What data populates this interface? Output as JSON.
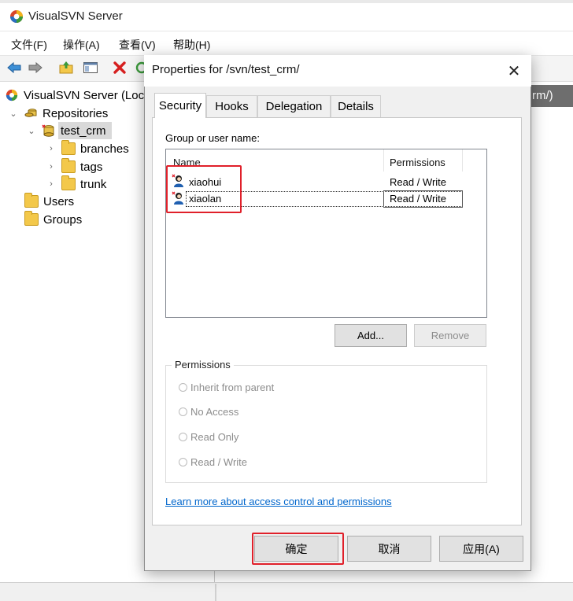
{
  "main_window": {
    "title": "VisualSVN Server",
    "menu": [
      "文件(F)",
      "操作(A)",
      "查看(V)",
      "帮助(H)"
    ],
    "right_header_text": "rm/)"
  },
  "tree": {
    "root": "VisualSVN Server (Loc",
    "repositories": "Repositories",
    "repo": "test_crm",
    "children": [
      "branches",
      "tags",
      "trunk"
    ],
    "users": "Users",
    "groups": "Groups"
  },
  "dialog": {
    "title": "Properties for /svn/test_crm/",
    "tabs": [
      "Security",
      "Hooks",
      "Delegation",
      "Details"
    ],
    "active_tab": "Security",
    "group_label": "Group or user name:",
    "columns": {
      "name": "Name",
      "permissions": "Permissions"
    },
    "users": [
      {
        "name": "xiaohui",
        "permission": "Read / Write"
      },
      {
        "name": "xiaolan",
        "permission": "Read / Write"
      }
    ],
    "add_button": "Add...",
    "remove_button": "Remove",
    "permissions_legend": "Permissions",
    "permission_options": [
      "Inherit from parent",
      "No Access",
      "Read Only",
      "Read / Write"
    ],
    "learn_link": "Learn more about access control and permissions",
    "ok_button": "确定",
    "cancel_button": "取消",
    "apply_button": "应用(A)"
  },
  "colors": {
    "accent_red": "#e0202a",
    "link_blue": "#0066cc",
    "folder_yellow": "#f3c84a"
  }
}
